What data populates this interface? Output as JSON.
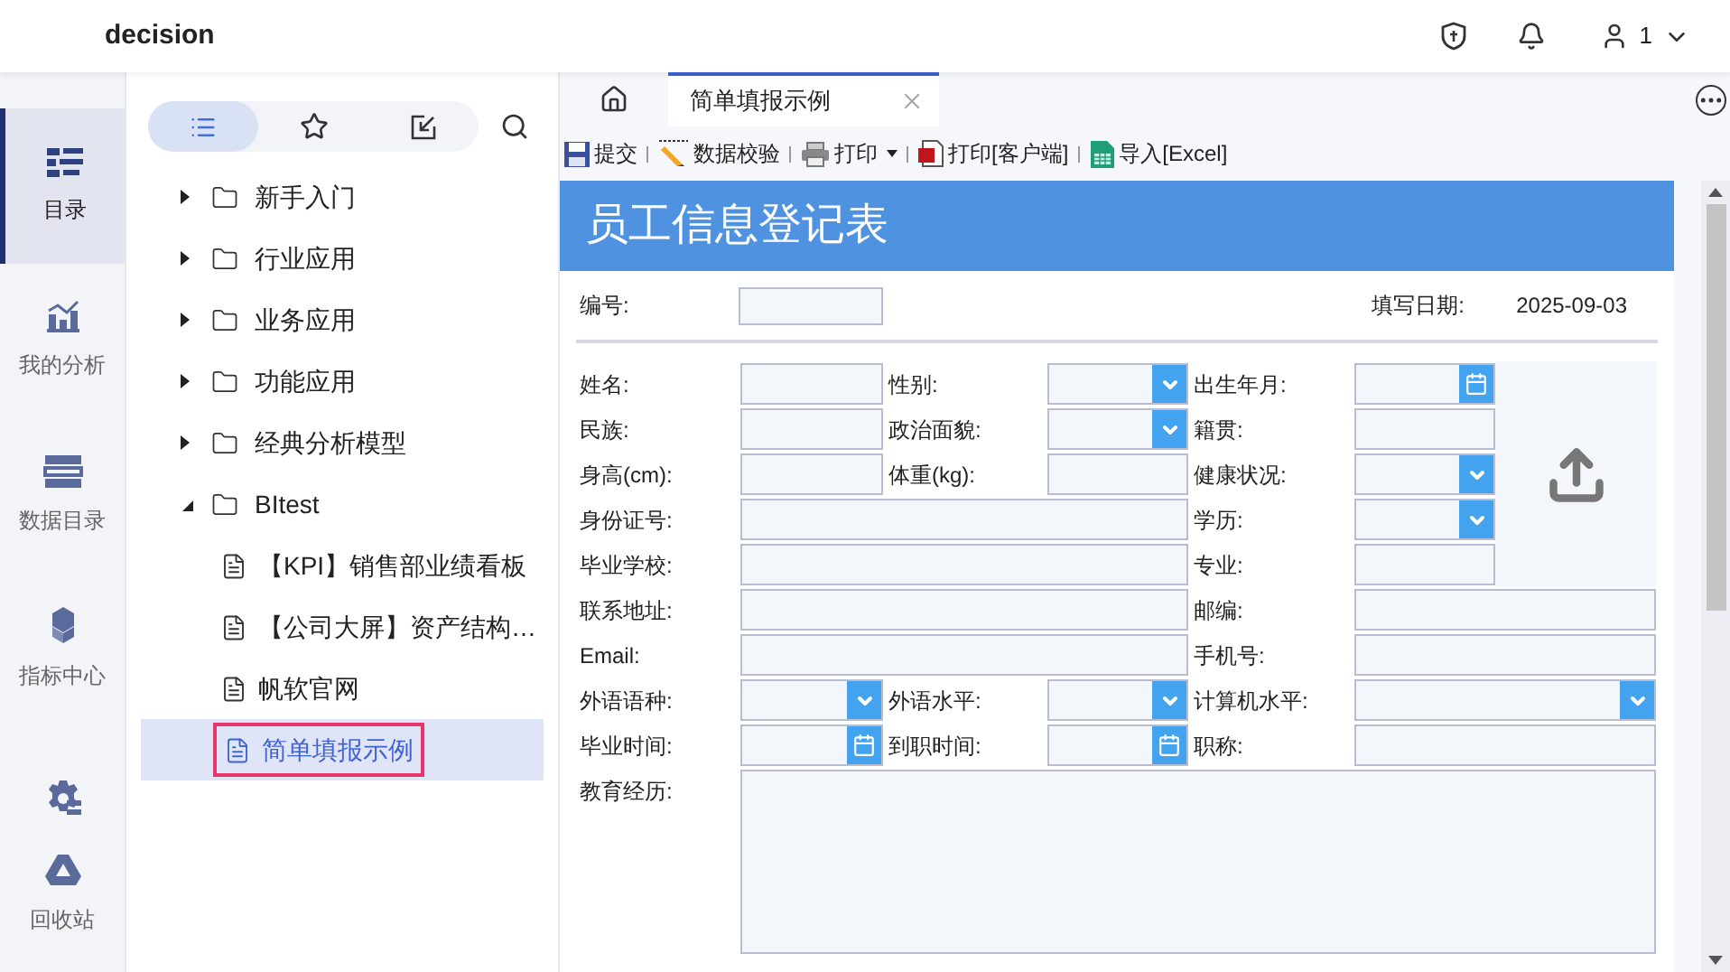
{
  "app": {
    "title": "decision",
    "user": "1"
  },
  "nav": [
    {
      "kind": "catalog",
      "label": "目录",
      "selected": true
    },
    {
      "kind": "analysis",
      "label": "我的分析",
      "selected": false
    },
    {
      "kind": "data",
      "label": "数据目录",
      "selected": false
    },
    {
      "kind": "metrics",
      "label": "指标中心",
      "selected": false
    },
    {
      "kind": "settings",
      "selected": false
    },
    {
      "kind": "recycle",
      "label": "回收站",
      "selected": false
    }
  ],
  "tree_tabs": [
    {
      "kind": "list",
      "selected": true
    },
    {
      "kind": "star",
      "selected": false
    },
    {
      "kind": "import",
      "selected": false
    }
  ],
  "tree": [
    {
      "label": "新手入门",
      "kind": "folder",
      "expanded": false
    },
    {
      "label": "行业应用",
      "kind": "folder",
      "expanded": false
    },
    {
      "label": "业务应用",
      "kind": "folder",
      "expanded": false
    },
    {
      "label": "功能应用",
      "kind": "folder",
      "expanded": false
    },
    {
      "label": "经典分析模型",
      "kind": "folder",
      "expanded": false
    },
    {
      "label": "BItest",
      "kind": "folder",
      "expanded": true,
      "children": [
        {
          "label": "【KPI】销售部业绩看板",
          "kind": "file",
          "selected": false
        },
        {
          "label": "【公司大屏】资产结构…",
          "kind": "file",
          "selected": false
        },
        {
          "label": "帆软官网",
          "kind": "file",
          "selected": false
        },
        {
          "label": "简单填报示例",
          "kind": "file",
          "selected": true
        }
      ]
    }
  ],
  "tabs": [
    {
      "label": "简单填报示例",
      "selected": true
    }
  ],
  "toolbar": [
    {
      "kind": "submit",
      "label": "提交"
    },
    {
      "kind": "validate",
      "label": "数据校验"
    },
    {
      "kind": "print",
      "label": "打印",
      "dropdown": true
    },
    {
      "kind": "print_client",
      "label": "打印[客户端]"
    },
    {
      "kind": "excel",
      "label": "导入[Excel]"
    }
  ],
  "form": {
    "title": "员工信息登记表",
    "number_label": "编号:",
    "date_label": "填写日期:",
    "date_value": "2025-09-03",
    "rows": [
      [
        {
          "label": "姓名:",
          "kind": "text"
        },
        {
          "label": "性别:",
          "kind": "select"
        },
        {
          "label": "出生年月:",
          "kind": "date"
        }
      ],
      [
        {
          "label": "民族:",
          "kind": "text"
        },
        {
          "label": "政治面貌:",
          "kind": "select"
        },
        {
          "label": "籍贯:",
          "kind": "text"
        }
      ],
      [
        {
          "label": "身高(cm):",
          "kind": "text"
        },
        {
          "label": "体重(kg):",
          "kind": "text"
        },
        {
          "label": "健康状况:",
          "kind": "select"
        }
      ],
      [
        {
          "label": "身份证号:",
          "kind": "text"
        },
        {
          "label": "学历:",
          "kind": "select"
        }
      ],
      [
        {
          "label": "毕业学校:",
          "kind": "text"
        },
        {
          "label": "专业:",
          "kind": "text"
        }
      ],
      [
        {
          "label": "联系地址:",
          "kind": "text"
        },
        {
          "label": "邮编:",
          "kind": "text"
        }
      ],
      [
        {
          "label": "Email:",
          "kind": "text"
        },
        {
          "label": "手机号:",
          "kind": "text"
        }
      ],
      [
        {
          "label": "外语语种:",
          "kind": "select"
        },
        {
          "label": "外语水平:",
          "kind": "select"
        },
        {
          "label": "计算机水平:",
          "kind": "select"
        }
      ],
      [
        {
          "label": "毕业时间:",
          "kind": "date"
        },
        {
          "label": "到职时间:",
          "kind": "date"
        },
        {
          "label": "职称:",
          "kind": "text"
        }
      ],
      [
        {
          "label": "教育经历:",
          "kind": "textarea"
        }
      ]
    ]
  }
}
